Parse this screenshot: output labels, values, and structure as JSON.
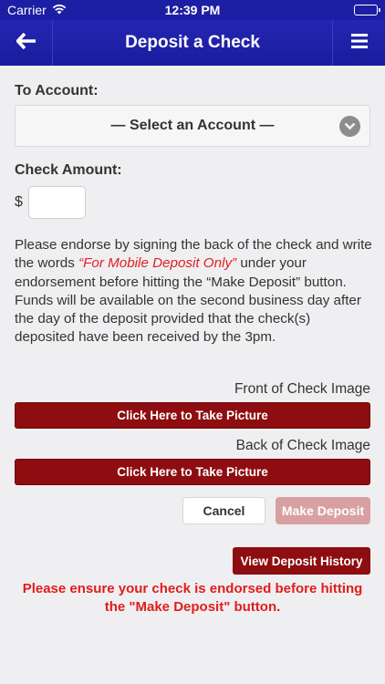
{
  "status_bar": {
    "carrier": "Carrier",
    "time": "12:39 PM",
    "icons": [
      "wifi-icon",
      "battery-icon"
    ]
  },
  "nav": {
    "title": "Deposit a Check",
    "back_icon": "arrow-left-icon",
    "menu_icon": "hamburger-menu-icon"
  },
  "form": {
    "account_label": "To Account:",
    "account_select": {
      "selected": "— Select an Account —",
      "icon": "chevron-down-icon"
    },
    "amount_label": "Check Amount:",
    "currency_symbol": "$",
    "amount_value": "",
    "instructions": {
      "part1": "Please endorse by signing the back of the check and write the words ",
      "emphasis": "“For Mobile Deposit Only”",
      "part2": " under your endorsement before hitting the “Make Deposit” button. Funds will be available on the second business day after the day of the deposit provided that the check(s) deposited have been received by the 3pm."
    },
    "front_label": "Front of Check Image",
    "front_button": "Click Here to Take Picture",
    "back_label": "Back of Check Image",
    "back_button": "Click Here to Take Picture",
    "cancel_button": "Cancel",
    "deposit_button": "Make Deposit",
    "history_button": "View Deposit History",
    "warning": "Please ensure your check is endorsed before hitting the \"Make Deposit\" button."
  },
  "colors": {
    "header_blue": "#1c1ea3",
    "button_red": "#8e0d10",
    "disabled_red": "#d9a0a2",
    "warning_red": "#e01d1d"
  }
}
